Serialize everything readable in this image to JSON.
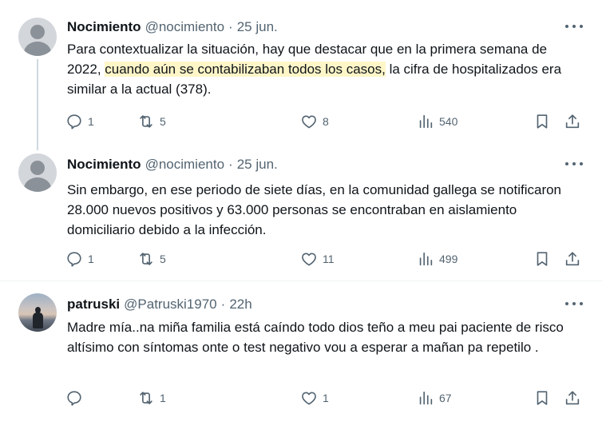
{
  "tweets": [
    {
      "name": "Nocimiento",
      "handle": "@nocimiento",
      "dot": "·",
      "time": "25 jun.",
      "text_before": "Para contextualizar la situación, hay que destacar que en la primera semana de 2022, ",
      "text_highlight": "cuando aún se contabilizaban todos los casos,",
      "text_after": " la cifra de hospitalizados era similar a la actual (378).",
      "replies": "1",
      "retweets": "5",
      "likes": "8",
      "views": "540"
    },
    {
      "name": "Nocimiento",
      "handle": "@nocimiento",
      "dot": "·",
      "time": "25 jun.",
      "text": "Sin embargo, en ese periodo de siete días, en la comunidad gallega se notificaron 28.000 nuevos positivos y 63.000 personas se encontraban en aislamiento domiciliario debido a la infección.",
      "replies": "1",
      "retweets": "5",
      "likes": "11",
      "views": "499"
    },
    {
      "name": "patruski",
      "handle": "@Patruski1970",
      "dot": "·",
      "time": "22h",
      "text": "Madre mía..na miña familia está caíndo todo dios teño a meu pai paciente de risco altísimo con síntomas onte o test negativo vou a esperar a mañan pa repetilo .",
      "replies": "",
      "retweets": "1",
      "likes": "1",
      "views": "67"
    }
  ],
  "icons": {
    "reply": "reply-icon",
    "retweet": "retweet-icon",
    "like": "heart-icon",
    "views": "views-icon",
    "bookmark": "bookmark-icon",
    "share": "share-icon",
    "more": "more-icon"
  },
  "colors": {
    "text": "#0f1419",
    "secondary": "#536471",
    "highlight": "#fff6c8",
    "thread_line": "#cfd9de",
    "divider": "#eff3f4"
  }
}
